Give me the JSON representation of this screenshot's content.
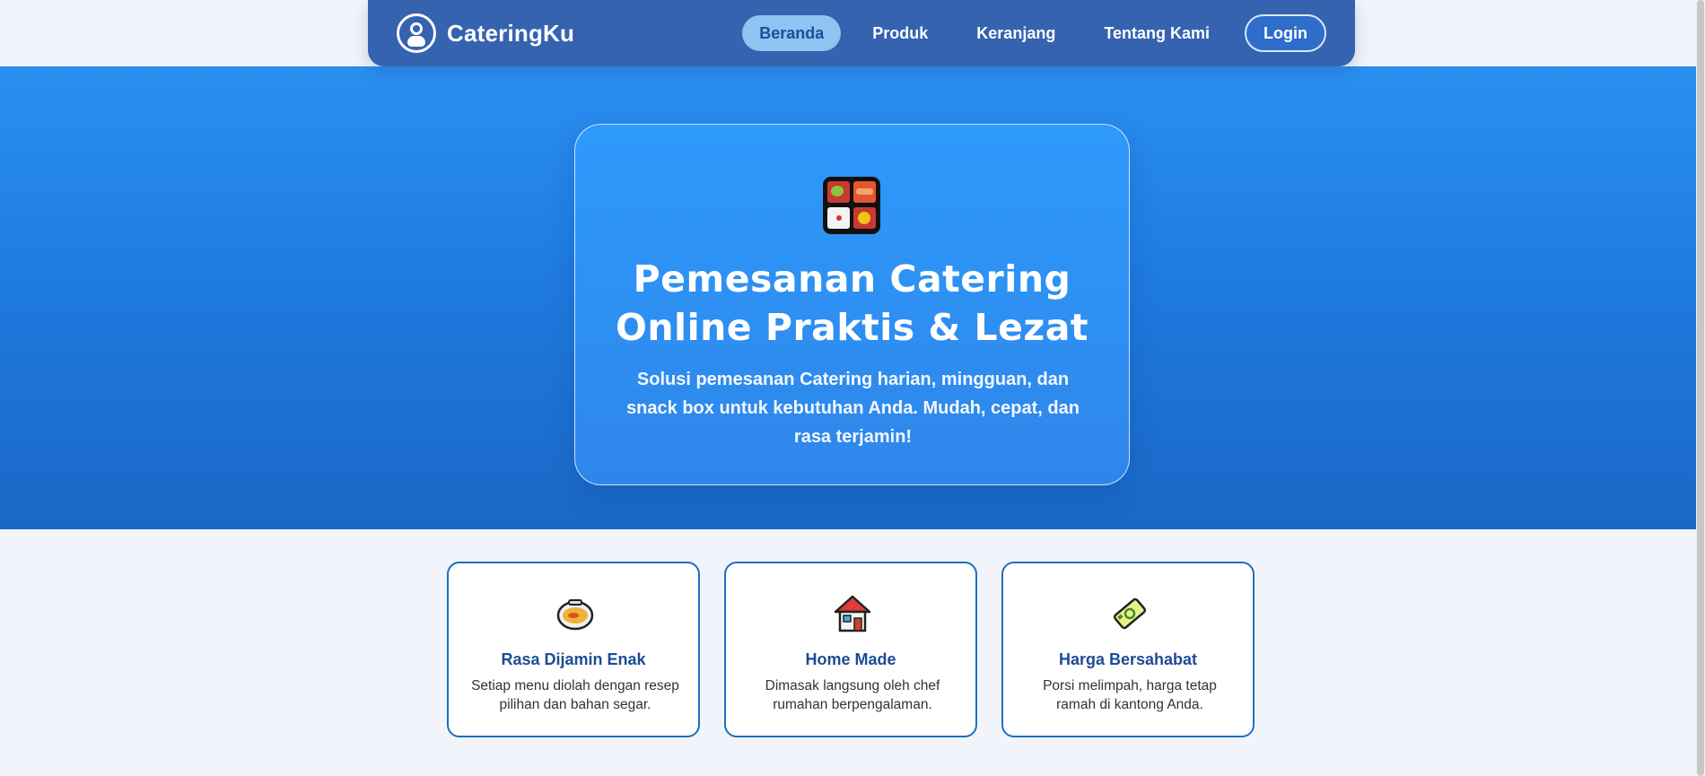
{
  "brand": {
    "name": "CateringKu",
    "logo_icon": "chef-avatar-icon"
  },
  "nav": {
    "items": [
      {
        "label": "Beranda",
        "active": true
      },
      {
        "label": "Produk",
        "active": false
      },
      {
        "label": "Keranjang",
        "active": false
      },
      {
        "label": "Tentang Kami",
        "active": false
      }
    ],
    "login_label": "Login"
  },
  "hero": {
    "icon": "bento-box-icon",
    "title_line1": "Pemesanan Catering",
    "title_line2": "Online Praktis & Lezat",
    "subtitle": "Solusi pemesanan Catering harian, mingguan, dan snack box untuk kebutuhan Anda. Mudah, cepat, dan rasa terjamin!"
  },
  "features": [
    {
      "icon": "food-bowl-icon",
      "title": "Rasa Dijamin Enak",
      "desc": "Setiap menu diolah dengan resep pilihan dan bahan segar."
    },
    {
      "icon": "house-icon",
      "title": "Home Made",
      "desc": "Dimasak langsung oleh chef rumahan berpengalaman."
    },
    {
      "icon": "money-tag-icon",
      "title": "Harga Bersahabat",
      "desc": "Porsi melimpah, harga tetap ramah di kantong Anda."
    }
  ],
  "colors": {
    "navbar": "#3563b0",
    "nav_active_bg": "#8ec3f2",
    "hero_top": "#2a8ff0",
    "hero_bottom": "#1a67c6",
    "feature_border": "#1f6fc2",
    "feature_title": "#1c4c94",
    "page_bg": "#f1f5fb"
  }
}
